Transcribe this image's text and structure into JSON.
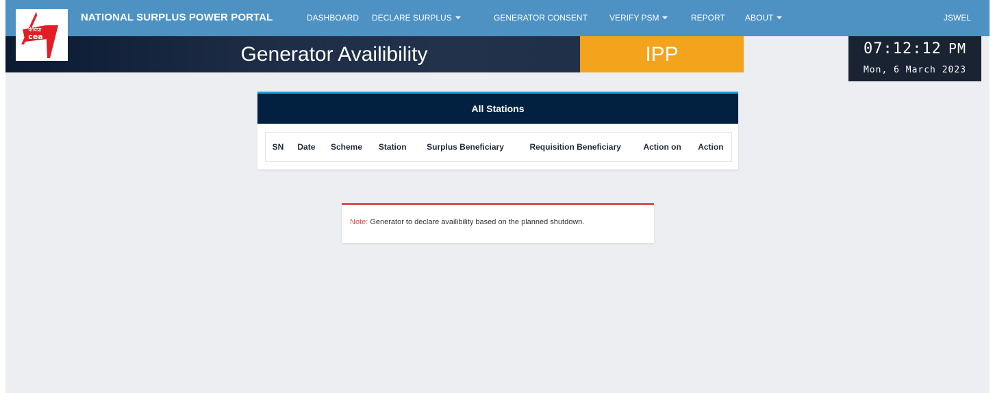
{
  "navbar": {
    "brand": "NATIONAL SURPLUS POWER PORTAL",
    "items": [
      {
        "label": "DASHBOARD",
        "dropdown": false
      },
      {
        "label": "DECLARE SURPLUS",
        "dropdown": true
      },
      {
        "label": "GENERATOR CONSENT",
        "dropdown": false
      },
      {
        "label": "VERIFY PSM",
        "dropdown": true
      },
      {
        "label": "REPORT",
        "dropdown": false
      },
      {
        "label": "ABOUT",
        "dropdown": true
      }
    ],
    "user": "JSWEL",
    "logo": {
      "hindi_text": "केविप्रा",
      "english_text": "cea",
      "icon": "cea-logo-icon"
    }
  },
  "header": {
    "title": "Generator Availibility",
    "badge": "IPP"
  },
  "clock": {
    "time": "07:12:12",
    "ampm": "PM",
    "date": "Mon, 6 March 2023"
  },
  "stations": {
    "title": "All Stations",
    "columns": [
      "SN",
      "Date",
      "Scheme",
      "Station",
      "Surplus Beneficiary",
      "Requisition Beneficiary",
      "Action on",
      "Action"
    ],
    "rows": []
  },
  "note": {
    "label": "Note:",
    "text": " Generator to declare availibility based on the planned shutdown."
  },
  "colors": {
    "navbar": "#4d92c3",
    "title_strip": "#1e2d45",
    "ipp_badge": "#f4a31d",
    "card_header": "#02203f",
    "card_accent": "#17a2d6",
    "note_accent": "#d9534f",
    "page_bg": "#eceef2"
  }
}
